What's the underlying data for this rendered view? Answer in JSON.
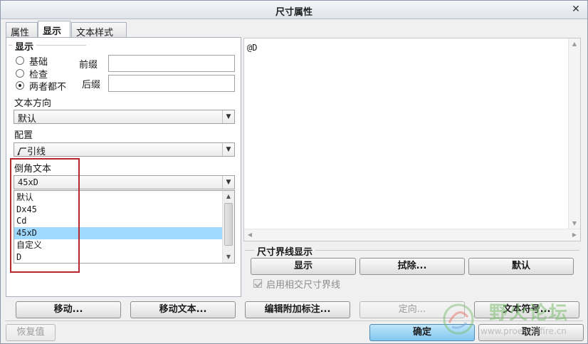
{
  "window": {
    "title": "尺寸属性"
  },
  "tabs": [
    {
      "label": "属性"
    },
    {
      "label": "显示"
    },
    {
      "label": "文本样式"
    }
  ],
  "display_group": {
    "title": "显示",
    "options": [
      {
        "label": "基础",
        "checked": false
      },
      {
        "label": "检查",
        "checked": false
      },
      {
        "label": "两者都不",
        "checked": true
      }
    ],
    "prefix_label": "前缀",
    "prefix_value": "",
    "suffix_label": "后缀",
    "suffix_value": ""
  },
  "text_direction": {
    "label": "文本方向",
    "value": "默认"
  },
  "configuration": {
    "label": "配置",
    "value": "引线"
  },
  "chamfer_text": {
    "label": "倒角文本",
    "value": "45xD",
    "options": [
      "默认",
      "Dx45",
      "Cd",
      "45xD",
      "自定义",
      "D"
    ],
    "selected_index": 3
  },
  "text_area": {
    "content": "@D"
  },
  "witness": {
    "title": "尺寸界线显示",
    "show_button": "显示",
    "erase_button": "拭除...",
    "default_button": "默认",
    "checkbox_label": "启用相交尺寸界线"
  },
  "bottom_buttons": {
    "move": "移动...",
    "move_text": "移动文本...",
    "edit_attach": "编辑附加标注...",
    "orient": "定向...",
    "text_symbol": "文本符号..."
  },
  "footer": {
    "restore": "恢复值",
    "ok": "确定",
    "cancel": "取消"
  },
  "watermark": {
    "name": "野火论坛",
    "url": "www.proewildfire.cn"
  },
  "colors": {
    "selection": "#9fd9ff",
    "highlight_frame": "#b3262c",
    "primary_button": "#82c6ef"
  }
}
